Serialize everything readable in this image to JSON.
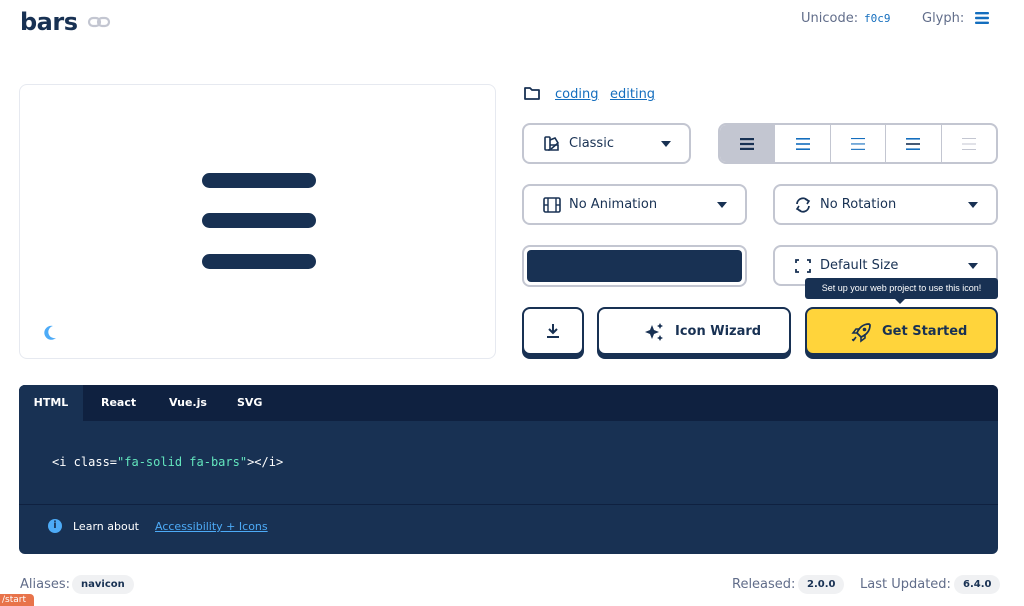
{
  "header": {
    "title": "bars",
    "unicode_label": "Unicode:",
    "unicode_value": "f0c9",
    "glyph_label": "Glyph:"
  },
  "categories": [
    "coding",
    "editing"
  ],
  "controls": {
    "family_select": "Classic",
    "animation_select": "No Animation",
    "rotation_select": "No Rotation",
    "size_select": "Default Size",
    "color_value": "#183153",
    "family_styles_active_index": 0
  },
  "tooltip": "Set up your web project to use this icon!",
  "buttons": {
    "icon_wizard": "Icon Wizard",
    "get_started": "Get Started"
  },
  "code": {
    "tabs": [
      "HTML",
      "React",
      "Vue.js",
      "SVG"
    ],
    "line_prefix": "<i class=",
    "line_string": "\"fa-solid fa-bars\"",
    "line_suffix": "></i>",
    "learn_text": "Learn about",
    "learn_link": "Accessibility + Icons"
  },
  "footer": {
    "aliases_label": "Aliases:",
    "alias": "navicon",
    "released_label": "Released:",
    "released_version": "2.0.0",
    "updated_label": "Last Updated:",
    "updated_version": "6.4.0",
    "status_url": "/start"
  },
  "colors": {
    "navy": "#183153",
    "yellow": "#ffd43b",
    "link_blue": "#146ebe",
    "moon_blue": "#4dabf7",
    "code_string": "#63e6be"
  },
  "icons": [
    "link-icon",
    "bars-icon",
    "moon-icon",
    "folder-icon",
    "palette-icon",
    "film-icon",
    "rotate-icon",
    "expand-icon",
    "download-icon",
    "sparkles-icon",
    "rocket-icon",
    "info-icon"
  ]
}
